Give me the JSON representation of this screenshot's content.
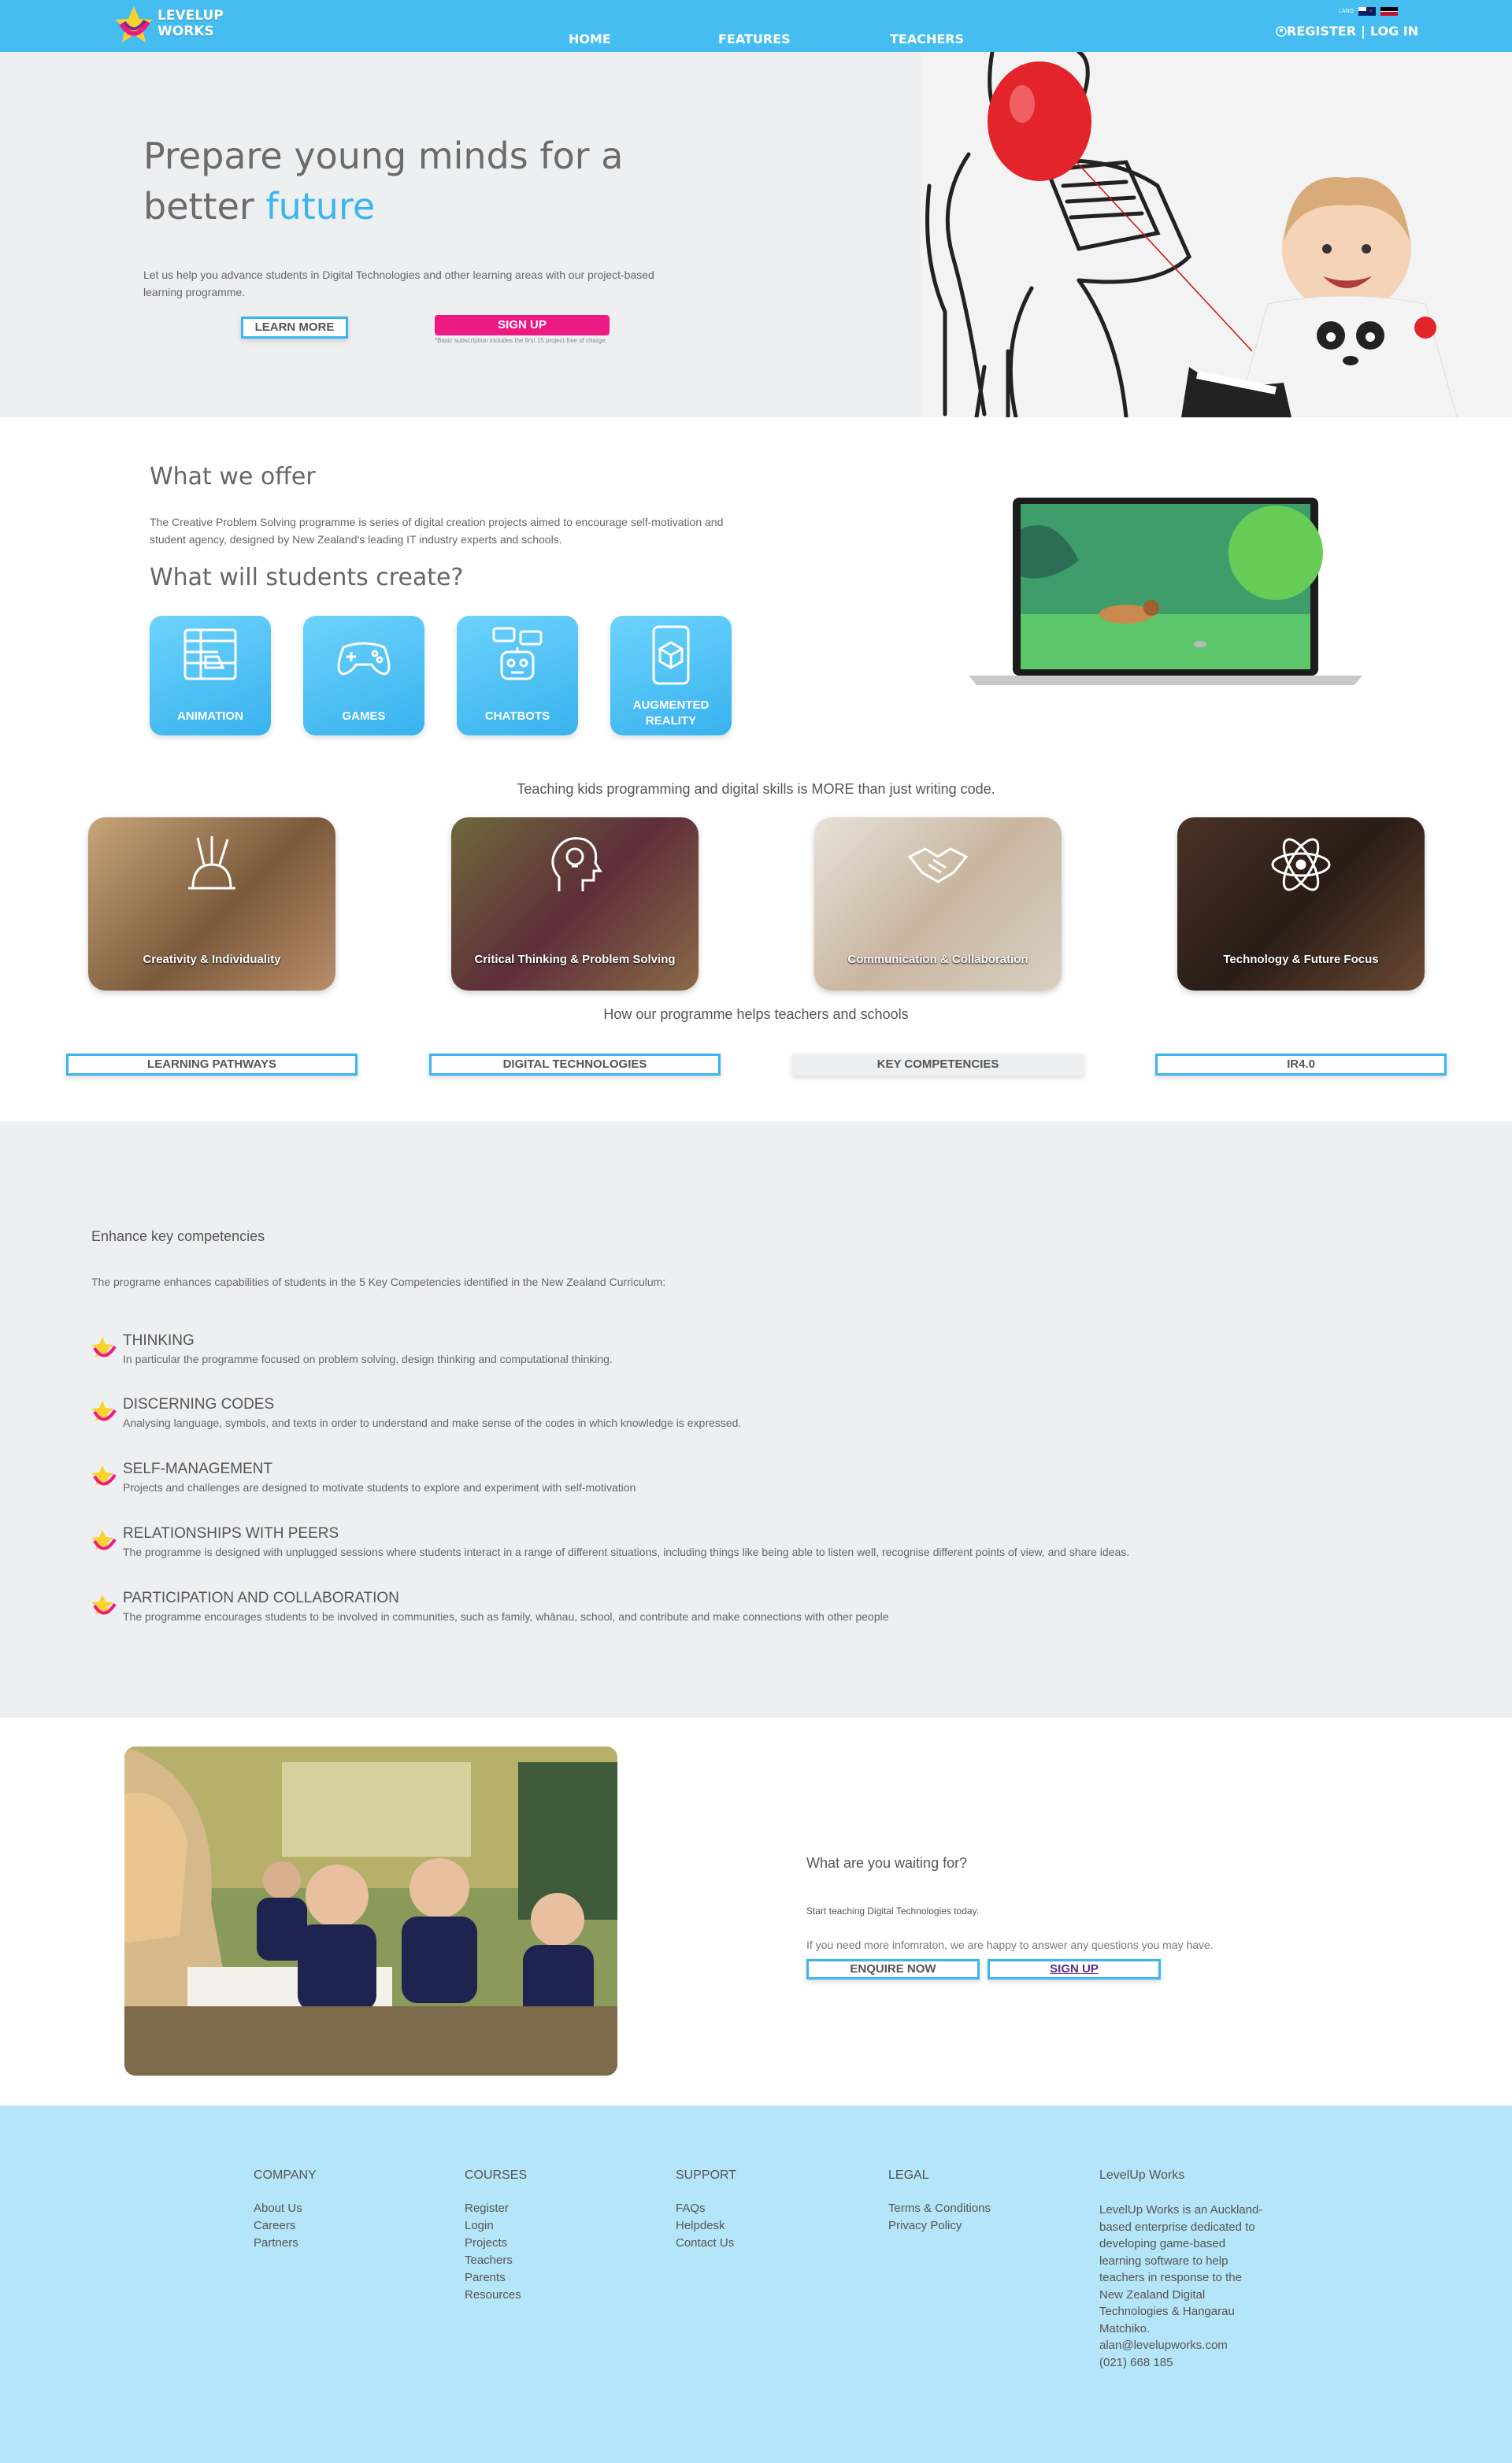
{
  "header": {
    "logo_line1": "LEVELUP",
    "logo_line2": "WORKS",
    "nav": [
      "HOME",
      "FEATURES",
      "TEACHERS"
    ],
    "lang_label": "LANG",
    "register": "REGISTER",
    "separator": "|",
    "login": "LOG IN",
    "colors": {
      "bar": "#45bdf0",
      "accent": "#3ab5ee",
      "pink": "#ee1a83"
    }
  },
  "hero": {
    "title_line1": "Prepare young minds for a",
    "title_line2_prefix": "better",
    "title_accent": "future",
    "description": "Let us help you advance students in Digital Technologies and other learning areas with our project-based learning programme.",
    "learn_more": "LEARN MORE",
    "sign_up": "SIGN UP",
    "note": "*Basic subscription includes the first 15 project free of charge."
  },
  "offer": {
    "title": "What we offer",
    "description": "The Creative Problem Solving programme is series of digital creation projects aimed to encourage self-motivation and student agency, designed by New Zealand's leading IT industry experts and schools.",
    "create_title": "What will students create?",
    "tiles": [
      {
        "label": "ANIMATION",
        "icon": "animation-icon"
      },
      {
        "label": "GAMES",
        "icon": "gamepad-icon"
      },
      {
        "label": "CHATBOTS",
        "icon": "chatbot-icon"
      },
      {
        "label": "AUGMENTED REALITY",
        "icon": "ar-phone-icon"
      }
    ]
  },
  "teaching": {
    "title": "Teaching kids programming and digital skills is MORE than just writing code.",
    "photos": [
      {
        "label": "Creativity & Individuality",
        "icon": "paint-tools-icon"
      },
      {
        "label": "Critical Thinking & Problem Solving",
        "icon": "lightbulb-head-icon"
      },
      {
        "label": "Communication & Collaboration",
        "icon": "handshake-icon"
      },
      {
        "label": "Technology & Future Focus",
        "icon": "atom-icon"
      }
    ],
    "help_title": "How our programme helps teachers and schools",
    "tabs": [
      "LEARNING PATHWAYS",
      "DIGITAL TECHNOLOGIES",
      "KEY COMPETENCIES",
      "IR4.0"
    ],
    "active_tab": "KEY COMPETENCIES"
  },
  "competencies": {
    "title": "Enhance key competencies",
    "intro": "The programe enhances capabilities of students in the 5 Key Competencies identified in the New Zealand Curriculum:",
    "items": [
      {
        "heading": "THINKING",
        "text": "In particular the programme focused on problem solving, design thinking and computational thinking."
      },
      {
        "heading": "DISCERNING CODES",
        "text": "Analysing language, symbols, and texts in order to understand and make sense of the codes in which knowledge is expressed."
      },
      {
        "heading": "SELF-MANAGEMENT",
        "text": "Projects and challenges are designed to motivate students to explore and experiment with self-motivation"
      },
      {
        "heading": "RELATIONSHIPS WITH PEERS",
        "text": "The programme is designed with unplugged sessions where students interact in a range of different situations, including things like being able to listen well, recognise different points of view, and share ideas."
      },
      {
        "heading": "PARTICIPATION AND COLLABORATION",
        "text": "The programme encourages students to be involved in communities, such as family, whānau, school, and contribute and make connections with other people"
      }
    ]
  },
  "cta": {
    "title": "What are you waiting for?",
    "line1": "Start teaching Digital Technologies today.",
    "line2": "If you need more infomraton, we are happy to answer any questions you may have.",
    "enquire": "ENQUIRE NOW",
    "sign_up": "SIGN UP"
  },
  "footer": {
    "company": {
      "heading": "COMPANY",
      "links": [
        "About Us",
        "Careers",
        "Partners"
      ]
    },
    "courses": {
      "heading": "COURSES",
      "links": [
        "Register",
        "Login",
        "Projects",
        "Teachers",
        "Parents",
        "Resources"
      ]
    },
    "support": {
      "heading": "SUPPORT",
      "links": [
        "FAQs",
        "Helpdesk",
        "Contact Us"
      ]
    },
    "legal": {
      "heading": "LEGAL",
      "links": [
        "Terms & Conditions",
        "Privacy Policy"
      ]
    },
    "about": {
      "heading": "LevelUp Works",
      "text": "LevelUp Works is an Auckland-based enterprise dedicated to developing game-based learning software to help teachers in response to the New Zealand Digital Technologies & Hangarau Matchiko.",
      "email": "alan@levelupworks.com",
      "phone": "(021) 668 185"
    }
  }
}
